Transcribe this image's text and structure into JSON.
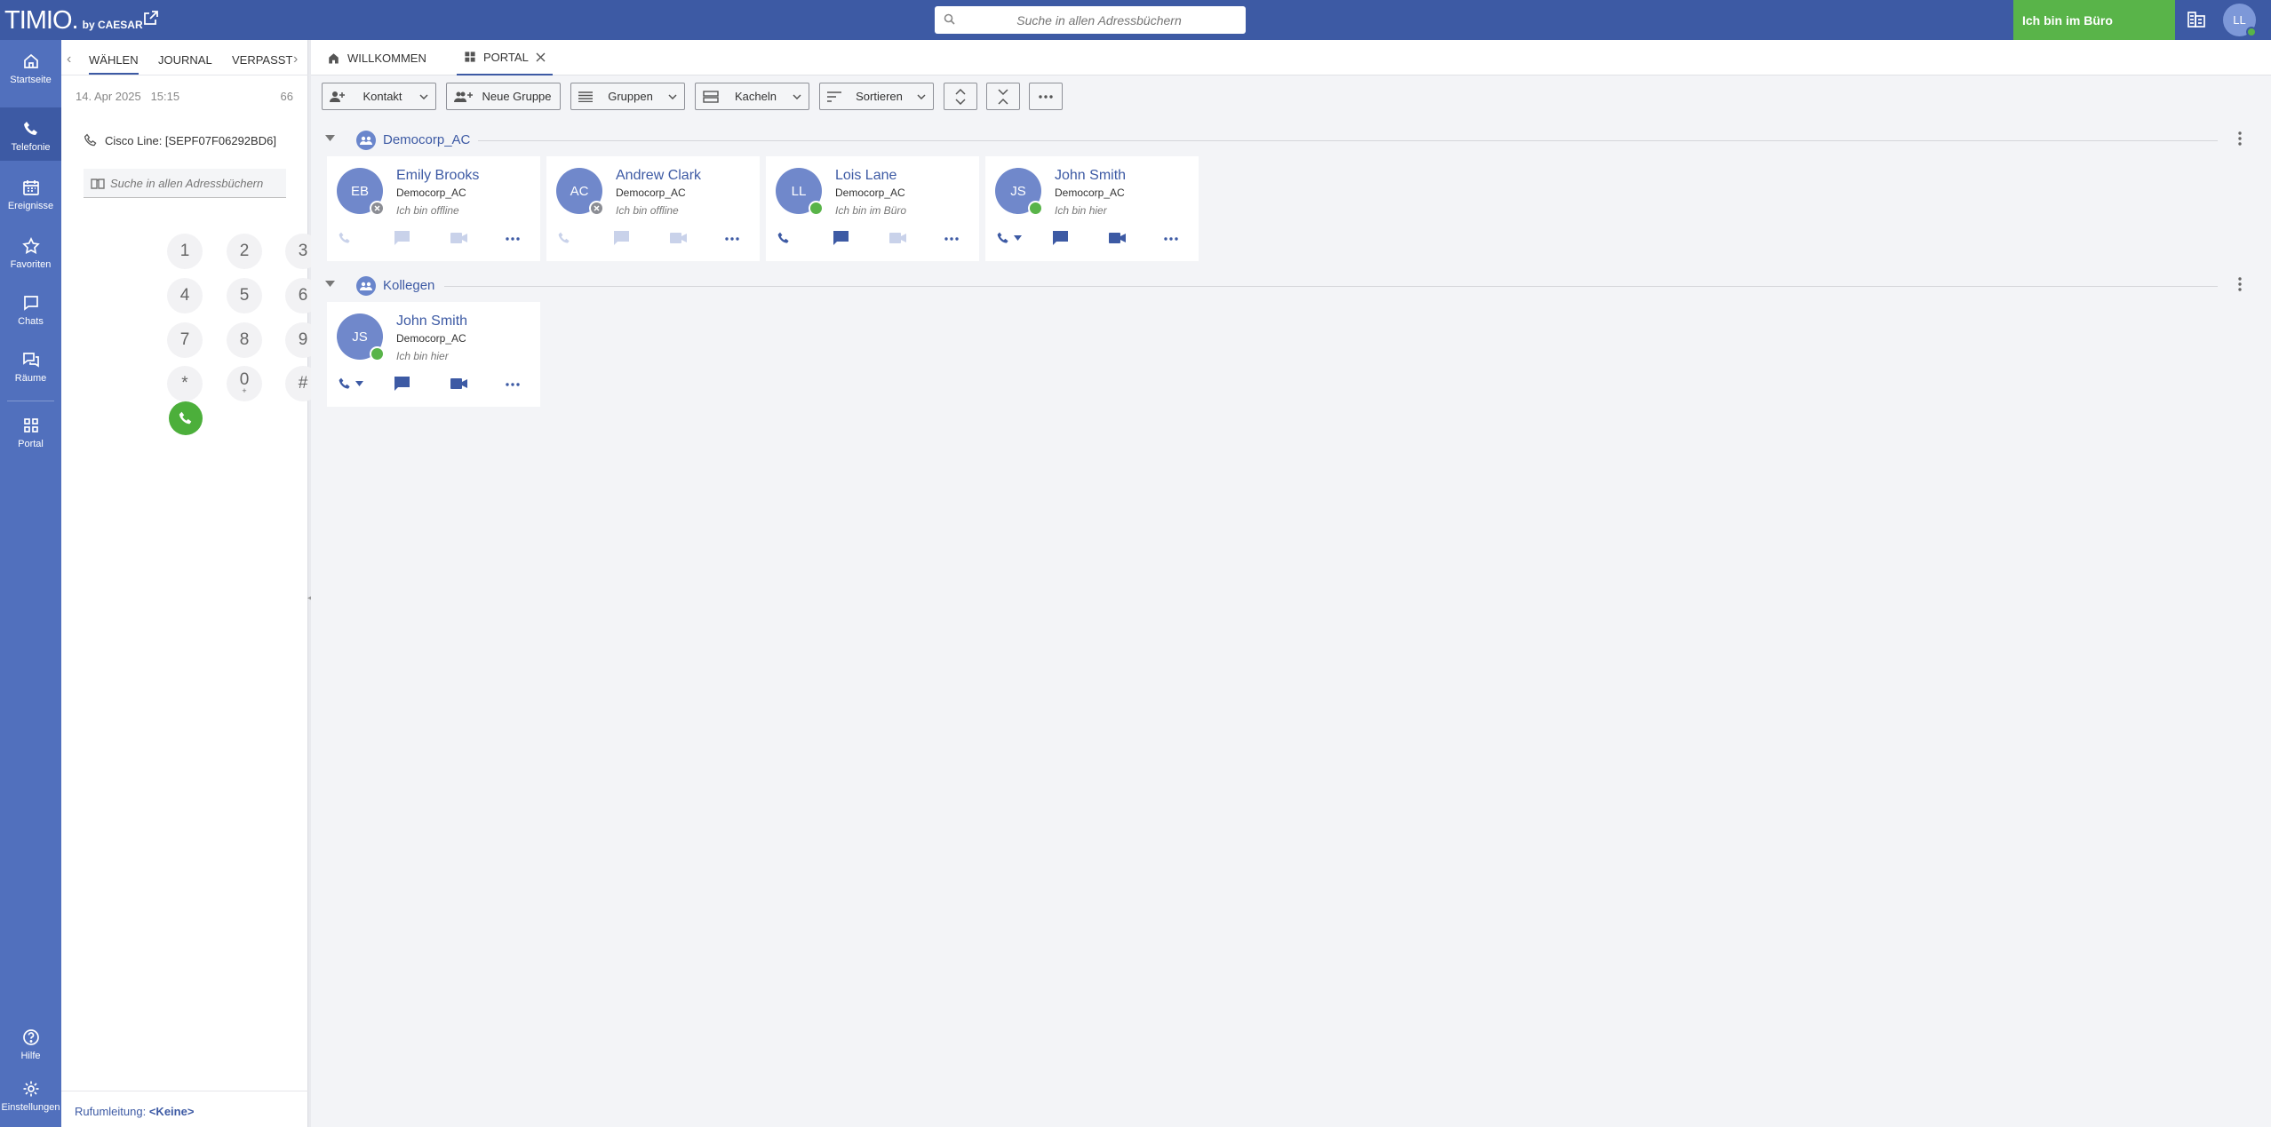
{
  "app": {
    "logo_main": "TIMIO.",
    "logo_sub": "by CAESAR"
  },
  "header": {
    "search_placeholder": "Suche in allen Adressbüchern",
    "status_label": "Ich bin im Büro",
    "user_initials": "LL"
  },
  "nav": {
    "items": [
      {
        "label": "Startseite",
        "icon": "home-icon"
      },
      {
        "label": "Telefonie",
        "icon": "phone-icon"
      },
      {
        "label": "Ereignisse",
        "icon": "calendar-icon"
      },
      {
        "label": "Favoriten",
        "icon": "star-icon"
      },
      {
        "label": "Chats",
        "icon": "chat-icon"
      },
      {
        "label": "Räume",
        "icon": "rooms-icon"
      },
      {
        "label": "Portal",
        "icon": "grid-icon"
      }
    ],
    "bottom": [
      {
        "label": "Hilfe",
        "icon": "help-icon"
      },
      {
        "label": "Einstellungen",
        "icon": "gear-icon"
      }
    ]
  },
  "phone_panel": {
    "tabs": [
      "WÄHLEN",
      "JOURNAL",
      "VERPASST"
    ],
    "date": "14. Apr 2025",
    "time": "15:15",
    "count": "66",
    "line_label": "Cisco Line: [SEPF07F06292BD6]",
    "search_placeholder": "Suche in allen Adressbüchern",
    "keys": [
      "1",
      "2",
      "3",
      "4",
      "5",
      "6",
      "7",
      "8",
      "9",
      "*",
      "0",
      "#"
    ],
    "zero_sub": "+",
    "forwarding_label": "Rufumleitung:",
    "forwarding_value": "<Keine>"
  },
  "main": {
    "tabs": [
      {
        "label": "WILLKOMMEN",
        "icon": "home-icon"
      },
      {
        "label": "PORTAL",
        "icon": "grid-icon"
      }
    ],
    "toolbar": {
      "contact": "Kontakt",
      "new_group": "Neue Gruppe",
      "groups": "Gruppen",
      "tiles": "Kacheln",
      "sort": "Sortieren"
    },
    "groups": [
      {
        "name": "Democorp_AC",
        "contacts": [
          {
            "initials": "EB",
            "name": "Emily Brooks",
            "company": "Democorp_AC",
            "status": "Ich bin offline",
            "presence": "offline"
          },
          {
            "initials": "AC",
            "name": "Andrew Clark",
            "company": "Democorp_AC",
            "status": "Ich bin offline",
            "presence": "offline"
          },
          {
            "initials": "LL",
            "name": "Lois Lane",
            "company": "Democorp_AC",
            "status": "Ich bin im Büro",
            "presence": "online"
          },
          {
            "initials": "JS",
            "name": "John Smith",
            "company": "Democorp_AC",
            "status": "Ich bin hier",
            "presence": "online"
          }
        ]
      },
      {
        "name": "Kollegen",
        "contacts": [
          {
            "initials": "JS",
            "name": "John Smith",
            "company": "Democorp_AC",
            "status": "Ich bin hier",
            "presence": "online"
          }
        ]
      }
    ]
  },
  "colors": {
    "primary": "#3d5aa4",
    "nav": "#5170bd",
    "online": "#59b449",
    "offline": "#8b8d94"
  }
}
